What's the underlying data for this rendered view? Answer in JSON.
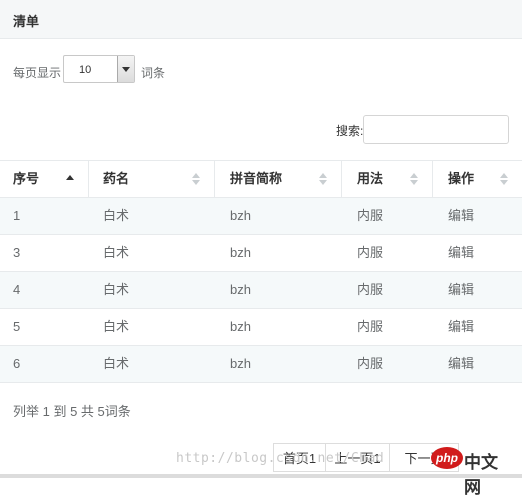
{
  "panel": {
    "title": "清单"
  },
  "length": {
    "prefix": "每页显示",
    "value": "10",
    "suffix": "词条"
  },
  "search": {
    "label": "搜索:",
    "value": ""
  },
  "table": {
    "headers": [
      "序号",
      "药名",
      "拼音简称",
      "用法",
      "操作"
    ],
    "sort": {
      "column": "序号",
      "direction": "asc"
    },
    "rows": [
      {
        "id": "1",
        "name": "白术",
        "pinyin": "bzh",
        "usage": "内服",
        "action": "编辑"
      },
      {
        "id": "3",
        "name": "白术",
        "pinyin": "bzh",
        "usage": "内服",
        "action": "编辑"
      },
      {
        "id": "4",
        "name": "白术",
        "pinyin": "bzh",
        "usage": "内服",
        "action": "编辑"
      },
      {
        "id": "5",
        "name": "白术",
        "pinyin": "bzh",
        "usage": "内服",
        "action": "编辑"
      },
      {
        "id": "6",
        "name": "白术",
        "pinyin": "bzh",
        "usage": "内服",
        "action": "编辑"
      }
    ]
  },
  "info": "列举 1 到 5 共 5词条",
  "pagination": {
    "first": "首页1",
    "prev": "上一页1",
    "next": "下一页"
  },
  "watermark": "http://blog.csdn.net/Chad",
  "logo": {
    "badge": "php",
    "text": "中文网"
  },
  "colors": {
    "header_bg": "#f5f7f8",
    "odd_row_bg": "#f5f9fa",
    "border": "#e7eaec",
    "logo_red": "#d11b1b"
  }
}
